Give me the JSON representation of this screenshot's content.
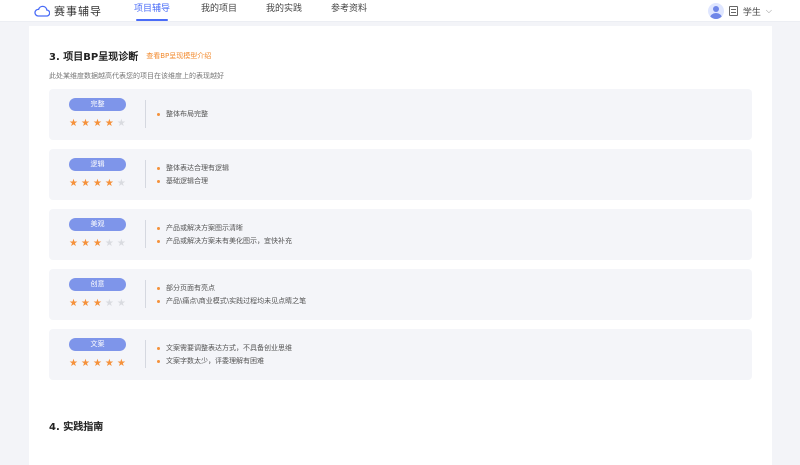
{
  "header": {
    "logo_text": "赛事辅导",
    "nav": [
      {
        "label": "项目辅导",
        "active": true
      },
      {
        "label": "我的项目",
        "active": false
      },
      {
        "label": "我的实践",
        "active": false
      },
      {
        "label": "参考资料",
        "active": false
      }
    ],
    "user": {
      "role": "学生"
    }
  },
  "section3": {
    "title": "3. 项目BP呈现诊断",
    "link": "查看BP呈现模型介绍",
    "desc": "此处某维度数据越高代表您的项目在该维度上的表现越好"
  },
  "dimensions": [
    {
      "tag": "完整",
      "stars": 4,
      "max_stars": 5,
      "items": [
        "整体布局完整"
      ]
    },
    {
      "tag": "逻辑",
      "stars": 4,
      "max_stars": 5,
      "items": [
        "整体表达合理有逻辑",
        "基础逻辑合理"
      ]
    },
    {
      "tag": "美观",
      "stars": 3,
      "max_stars": 5,
      "items": [
        "产品或解决方案图示清晰",
        "产品或解决方案未有美化图示，宜快补充"
      ]
    },
    {
      "tag": "创意",
      "stars": 3,
      "max_stars": 5,
      "items": [
        "部分页面有亮点",
        "产品\\痛点\\商业模式\\实践过程均未见点睛之笔"
      ]
    },
    {
      "tag": "文案",
      "stars": 5,
      "max_stars": 5,
      "items": [
        "文案需要调整表达方式，不具备创业思维",
        "文案字数太少，评委理解有困难"
      ]
    }
  ],
  "section4": {
    "title": "4. 实践指南"
  },
  "colors": {
    "accent": "#4a6cf7",
    "tag": "#7e95ea",
    "star": "#f5913b",
    "bullet": "#f5913b"
  }
}
